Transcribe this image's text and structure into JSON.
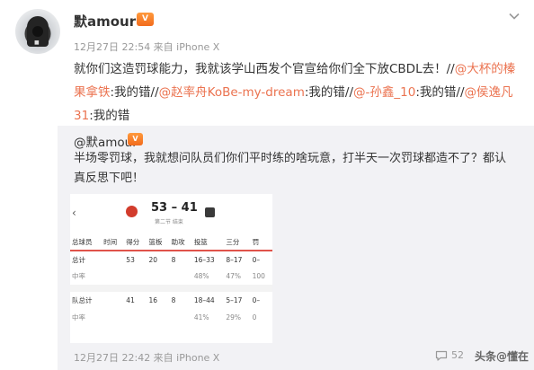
{
  "post": {
    "username": "默amour",
    "badge": "V",
    "meta": "12月27日 22:54 来自 iPhone X",
    "text_intro": "就你们这造罚球能力，我就该学山西发个官宣给你们全下放CBDL去！//",
    "mentions": [
      {
        "name": "@大杯的榛果拿铁",
        "comment": ":我的错//"
      },
      {
        "name": "@赵率舟KoBe-my-dream",
        "comment": ":我的错//"
      },
      {
        "name": "@-孙鑫_10",
        "comment": ":我的错//"
      },
      {
        "name": "@侯逸凡31",
        "comment": ":我的错"
      }
    ]
  },
  "repost": {
    "username": "@默amour",
    "badge": "V",
    "text": "半场零罚球，我就想问队员们你们平时练的啥玩意，打半天一次罚球都造不了？都认真反思下吧！",
    "footer_meta": "12月27日 22:42 来自 iPhone X",
    "comment_count": "52",
    "watermark": "头条@懂在一"
  },
  "stats_image": {
    "score": "53 – 41",
    "score_sub": "第二节 结束",
    "headers": [
      "总球员",
      "时间",
      "得分",
      "篮板",
      "助攻",
      "投篮",
      "三分",
      "罚"
    ],
    "rows": [
      {
        "cells": [
          "总计",
          "",
          "53",
          "20",
          "8",
          "16–33",
          "8–17",
          "0–"
        ],
        "muted": false
      },
      {
        "cells": [
          "中率",
          "",
          "",
          "",
          "",
          "48%",
          "47%",
          "100"
        ],
        "muted": true
      },
      {
        "cells": [
          "队总计",
          "",
          "41",
          "16",
          "8",
          "18–44",
          "5–17",
          "0–"
        ],
        "muted": false
      },
      {
        "cells": [
          "中率",
          "",
          "",
          "",
          "",
          "41%",
          "29%",
          "0"
        ],
        "muted": true
      }
    ]
  },
  "colors": {
    "mention": "#eb7350",
    "badge": "#f26b1d",
    "repost_bg": "#f2f2f5",
    "table_accent": "#e0534a"
  },
  "icons": {
    "chevron": "chevron-down-icon",
    "back": "back-arrow-icon",
    "comment": "comment-icon"
  }
}
